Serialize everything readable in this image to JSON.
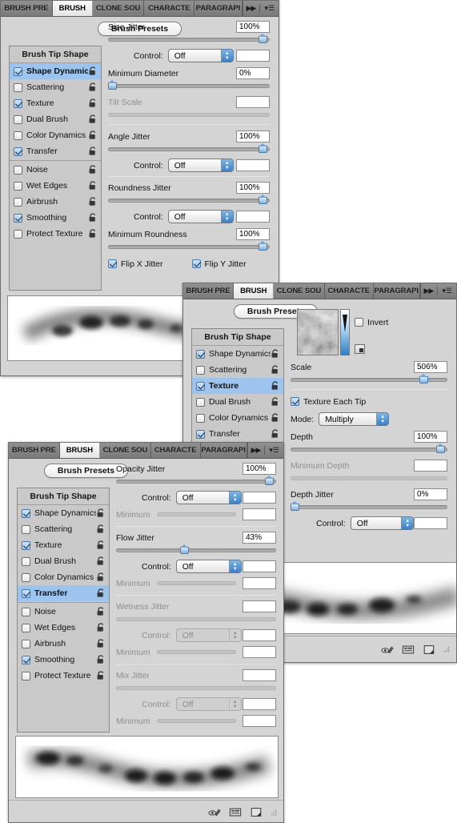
{
  "tabs": [
    "BRUSH PRE",
    "BRUSH",
    "CLONE SOU",
    "CHARACTE",
    "PARAGRAPI"
  ],
  "active_tab": "BRUSH",
  "tab_tools": {
    "expand_icon": "double-chevron-icon",
    "menu_icon": "panel-menu-icon"
  },
  "common": {
    "presets_button": "Brush Presets",
    "list_header": "Brush Tip Shape",
    "control_label": "Control:",
    "minimum_label": "Minimum",
    "off_value": "Off",
    "brush_options": [
      {
        "label": "Shape Dynamics",
        "checked": true
      },
      {
        "label": "Scattering",
        "checked": false
      },
      {
        "label": "Texture",
        "checked": true
      },
      {
        "label": "Dual Brush",
        "checked": false
      },
      {
        "label": "Color Dynamics",
        "checked": false
      },
      {
        "label": "Transfer",
        "checked": true
      },
      {
        "label": "Noise",
        "checked": false
      },
      {
        "label": "Wet Edges",
        "checked": false
      },
      {
        "label": "Airbrush",
        "checked": false
      },
      {
        "label": "Smoothing",
        "checked": true
      },
      {
        "label": "Protect Texture",
        "checked": false
      }
    ],
    "footer_icons": [
      "brush-preview-toggle-icon",
      "brush-panel-icon",
      "new-brush-icon"
    ]
  },
  "panel1": {
    "selected_option": "Shape Dynamics",
    "rows": [
      {
        "label": "Size Jitter",
        "value": "100%",
        "slider": 97,
        "dim": false
      },
      {
        "label": "Control:",
        "value": "",
        "dropdown": "Off",
        "dim": false
      },
      {
        "label": "Minimum Diameter",
        "value": "0%",
        "slider": 2,
        "dim": false
      },
      {
        "label": "Tilt Scale",
        "value": "",
        "slider": null,
        "dim": true
      },
      {
        "label": "Angle Jitter",
        "value": "100%",
        "slider": 97,
        "dim": false
      },
      {
        "label": "Control:",
        "value": "",
        "dropdown": "Off",
        "dim": false
      },
      {
        "label": "Roundness Jitter",
        "value": "100%",
        "slider": 97,
        "dim": false
      },
      {
        "label": "Control:",
        "value": "",
        "dropdown": "Off",
        "dim": false
      },
      {
        "label": "Minimum Roundness",
        "value": "100%",
        "slider": 97,
        "dim": false
      }
    ],
    "flip_x": {
      "label": "Flip X Jitter",
      "checked": true
    },
    "flip_y": {
      "label": "Flip Y Jitter",
      "checked": true
    }
  },
  "panel2": {
    "selected_option": "Texture",
    "invert": {
      "label": "Invert",
      "checked": false
    },
    "texture_thumbnail": "cloud-texture-thumbnail",
    "scale": {
      "label": "Scale",
      "value": "506%",
      "slider": 86
    },
    "texture_each_tip": {
      "label": "Texture Each Tip",
      "checked": true
    },
    "mode": {
      "label": "Mode:",
      "value": "Multiply"
    },
    "depth": {
      "label": "Depth",
      "value": "100%",
      "slider": 97
    },
    "minimum_depth": {
      "label": "Minimum Depth",
      "value": ""
    },
    "depth_jitter": {
      "label": "Depth Jitter",
      "value": "0%",
      "slider": 2
    },
    "control": {
      "label": "Control:",
      "value": "Off"
    }
  },
  "panel3": {
    "selected_option": "Transfer",
    "rows": [
      {
        "label": "Opacity Jitter",
        "value": "100%",
        "slider": 97,
        "dim": false
      },
      {
        "label": "Control:",
        "value": "",
        "dropdown": "Off",
        "dim": false
      },
      {
        "label": "Minimum",
        "value": "",
        "slider": null,
        "dim": true
      },
      {
        "label": "Flow Jitter",
        "value": "43%",
        "slider": 43,
        "dim": false
      },
      {
        "label": "Control:",
        "value": "",
        "dropdown": "Off",
        "dim": false
      },
      {
        "label": "Minimum",
        "value": "",
        "slider": null,
        "dim": true
      },
      {
        "label": "Wetness Jitter",
        "value": "",
        "slider": null,
        "dim": true
      },
      {
        "label": "Control:",
        "value": "",
        "dropdown": "Off",
        "dim": true
      },
      {
        "label": "Minimum",
        "value": "",
        "slider": null,
        "dim": true
      },
      {
        "label": "Mix Jitter",
        "value": "",
        "slider": null,
        "dim": true
      },
      {
        "label": "Control:",
        "value": "",
        "dropdown": "Off",
        "dim": true
      },
      {
        "label": "Minimum",
        "value": "",
        "slider": null,
        "dim": true
      }
    ]
  }
}
